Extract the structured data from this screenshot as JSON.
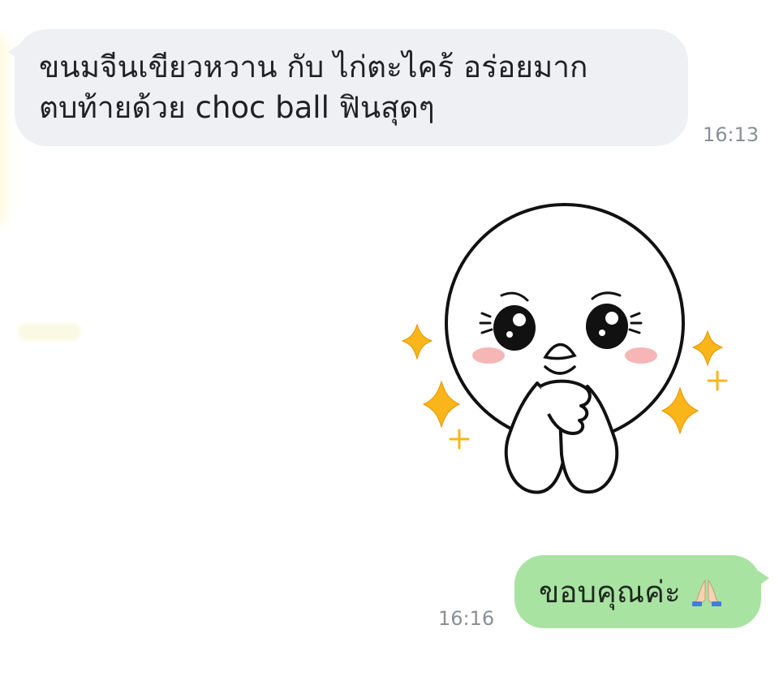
{
  "messages": {
    "incoming": {
      "line1": "ขนมจีนเขียวหวาน กับ ไก่ตะไคร้  อร่อยมาก",
      "line2": "ตบท้ายด้วย choc ball ฟินสุดๆ",
      "time": "16:13"
    },
    "sticker": {
      "icon": "praying-moon-sticker"
    },
    "outgoing": {
      "text": "ขอบคุณค่ะ",
      "emoji_icon": "folded-hands-icon",
      "time": "16:16"
    }
  },
  "colors": {
    "incoming_bubble": "#eef0f3",
    "outgoing_bubble": "#a9e3a2",
    "timestamp": "#8a8f96",
    "sparkle": "#f9b51a"
  }
}
